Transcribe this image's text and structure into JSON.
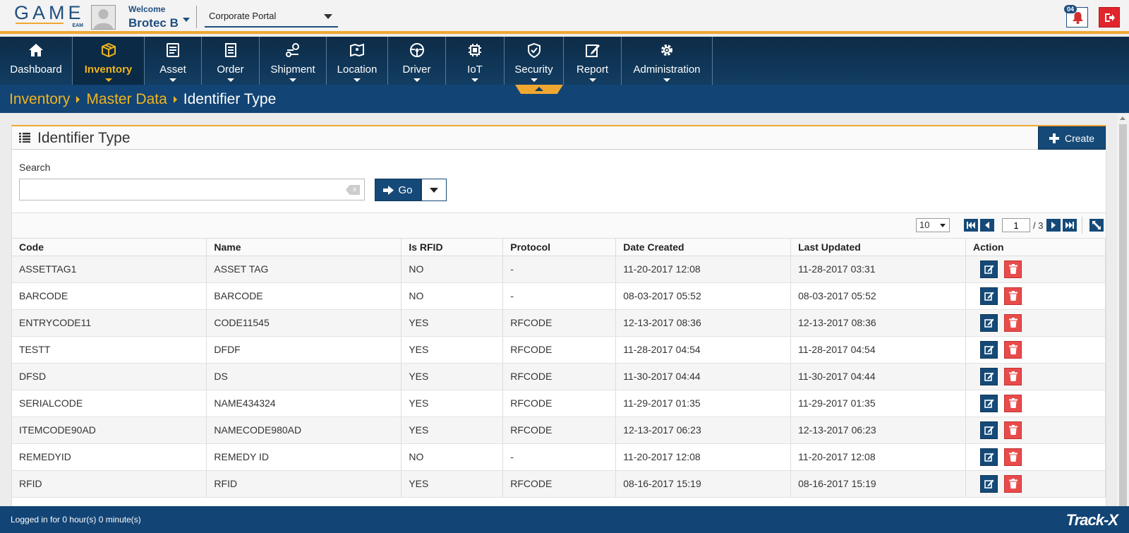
{
  "header": {
    "logo_text": "GAME",
    "logo_sub": "EAM",
    "welcome_label": "Welcome",
    "user_name": "Brotec B",
    "portal": "Corporate Portal",
    "notification_count": "04"
  },
  "nav": [
    {
      "label": "Dashboard",
      "icon": "home-icon"
    },
    {
      "label": "Inventory",
      "icon": "box-icon",
      "active": true
    },
    {
      "label": "Asset",
      "icon": "asset-icon"
    },
    {
      "label": "Order",
      "icon": "order-icon"
    },
    {
      "label": "Shipment",
      "icon": "shipment-icon"
    },
    {
      "label": "Location",
      "icon": "map-icon"
    },
    {
      "label": "Driver",
      "icon": "steering-wheel-icon"
    },
    {
      "label": "IoT",
      "icon": "chip-icon"
    },
    {
      "label": "Security",
      "icon": "shield-icon"
    },
    {
      "label": "Report",
      "icon": "edit-icon"
    },
    {
      "label": "Administration",
      "icon": "gear-icon"
    }
  ],
  "breadcrumb": {
    "items": [
      "Inventory",
      "Master Data"
    ],
    "current": "Identifier Type"
  },
  "panel": {
    "title": "Identifier Type",
    "create_label": "Create",
    "search_label": "Search",
    "search_value": "",
    "go_label": "Go"
  },
  "pager": {
    "page_size": "10",
    "current_page": "1",
    "total_pages": "/ 3"
  },
  "table": {
    "columns": [
      "Code",
      "Name",
      "Is RFID",
      "Protocol",
      "Date Created",
      "Last Updated",
      "Action"
    ],
    "rows": [
      [
        "ASSETTAG1",
        "ASSET TAG",
        "NO",
        "-",
        "11-20-2017 12:08",
        "11-28-2017 03:31"
      ],
      [
        "BARCODE",
        "BARCODE",
        "NO",
        "-",
        "08-03-2017 05:52",
        "08-03-2017 05:52"
      ],
      [
        "ENTRYCODE11",
        "CODE11545",
        "YES",
        "RFCODE",
        "12-13-2017 08:36",
        "12-13-2017 08:36"
      ],
      [
        "TESTT",
        "DFDF",
        "YES",
        "RFCODE",
        "11-28-2017 04:54",
        "11-28-2017 04:54"
      ],
      [
        "DFSD",
        "DS",
        "YES",
        "RFCODE",
        "11-30-2017 04:44",
        "11-30-2017 04:44"
      ],
      [
        "SERIALCODE",
        "NAME434324",
        "YES",
        "RFCODE",
        "11-29-2017 01:35",
        "11-29-2017 01:35"
      ],
      [
        "ITEMCODE90AD",
        "NAMECODE980AD",
        "YES",
        "RFCODE",
        "12-13-2017 06:23",
        "12-13-2017 06:23"
      ],
      [
        "REMEDYID",
        "REMEDY ID",
        "NO",
        "-",
        "11-20-2017 12:08",
        "11-20-2017 12:08"
      ],
      [
        "RFID",
        "RFID",
        "YES",
        "RFCODE",
        "08-16-2017 15:19",
        "08-16-2017 15:19"
      ]
    ]
  },
  "footer": {
    "login_status": "Logged in for 0 hour(s) 0 minute(s)",
    "brand": "Track-X"
  }
}
